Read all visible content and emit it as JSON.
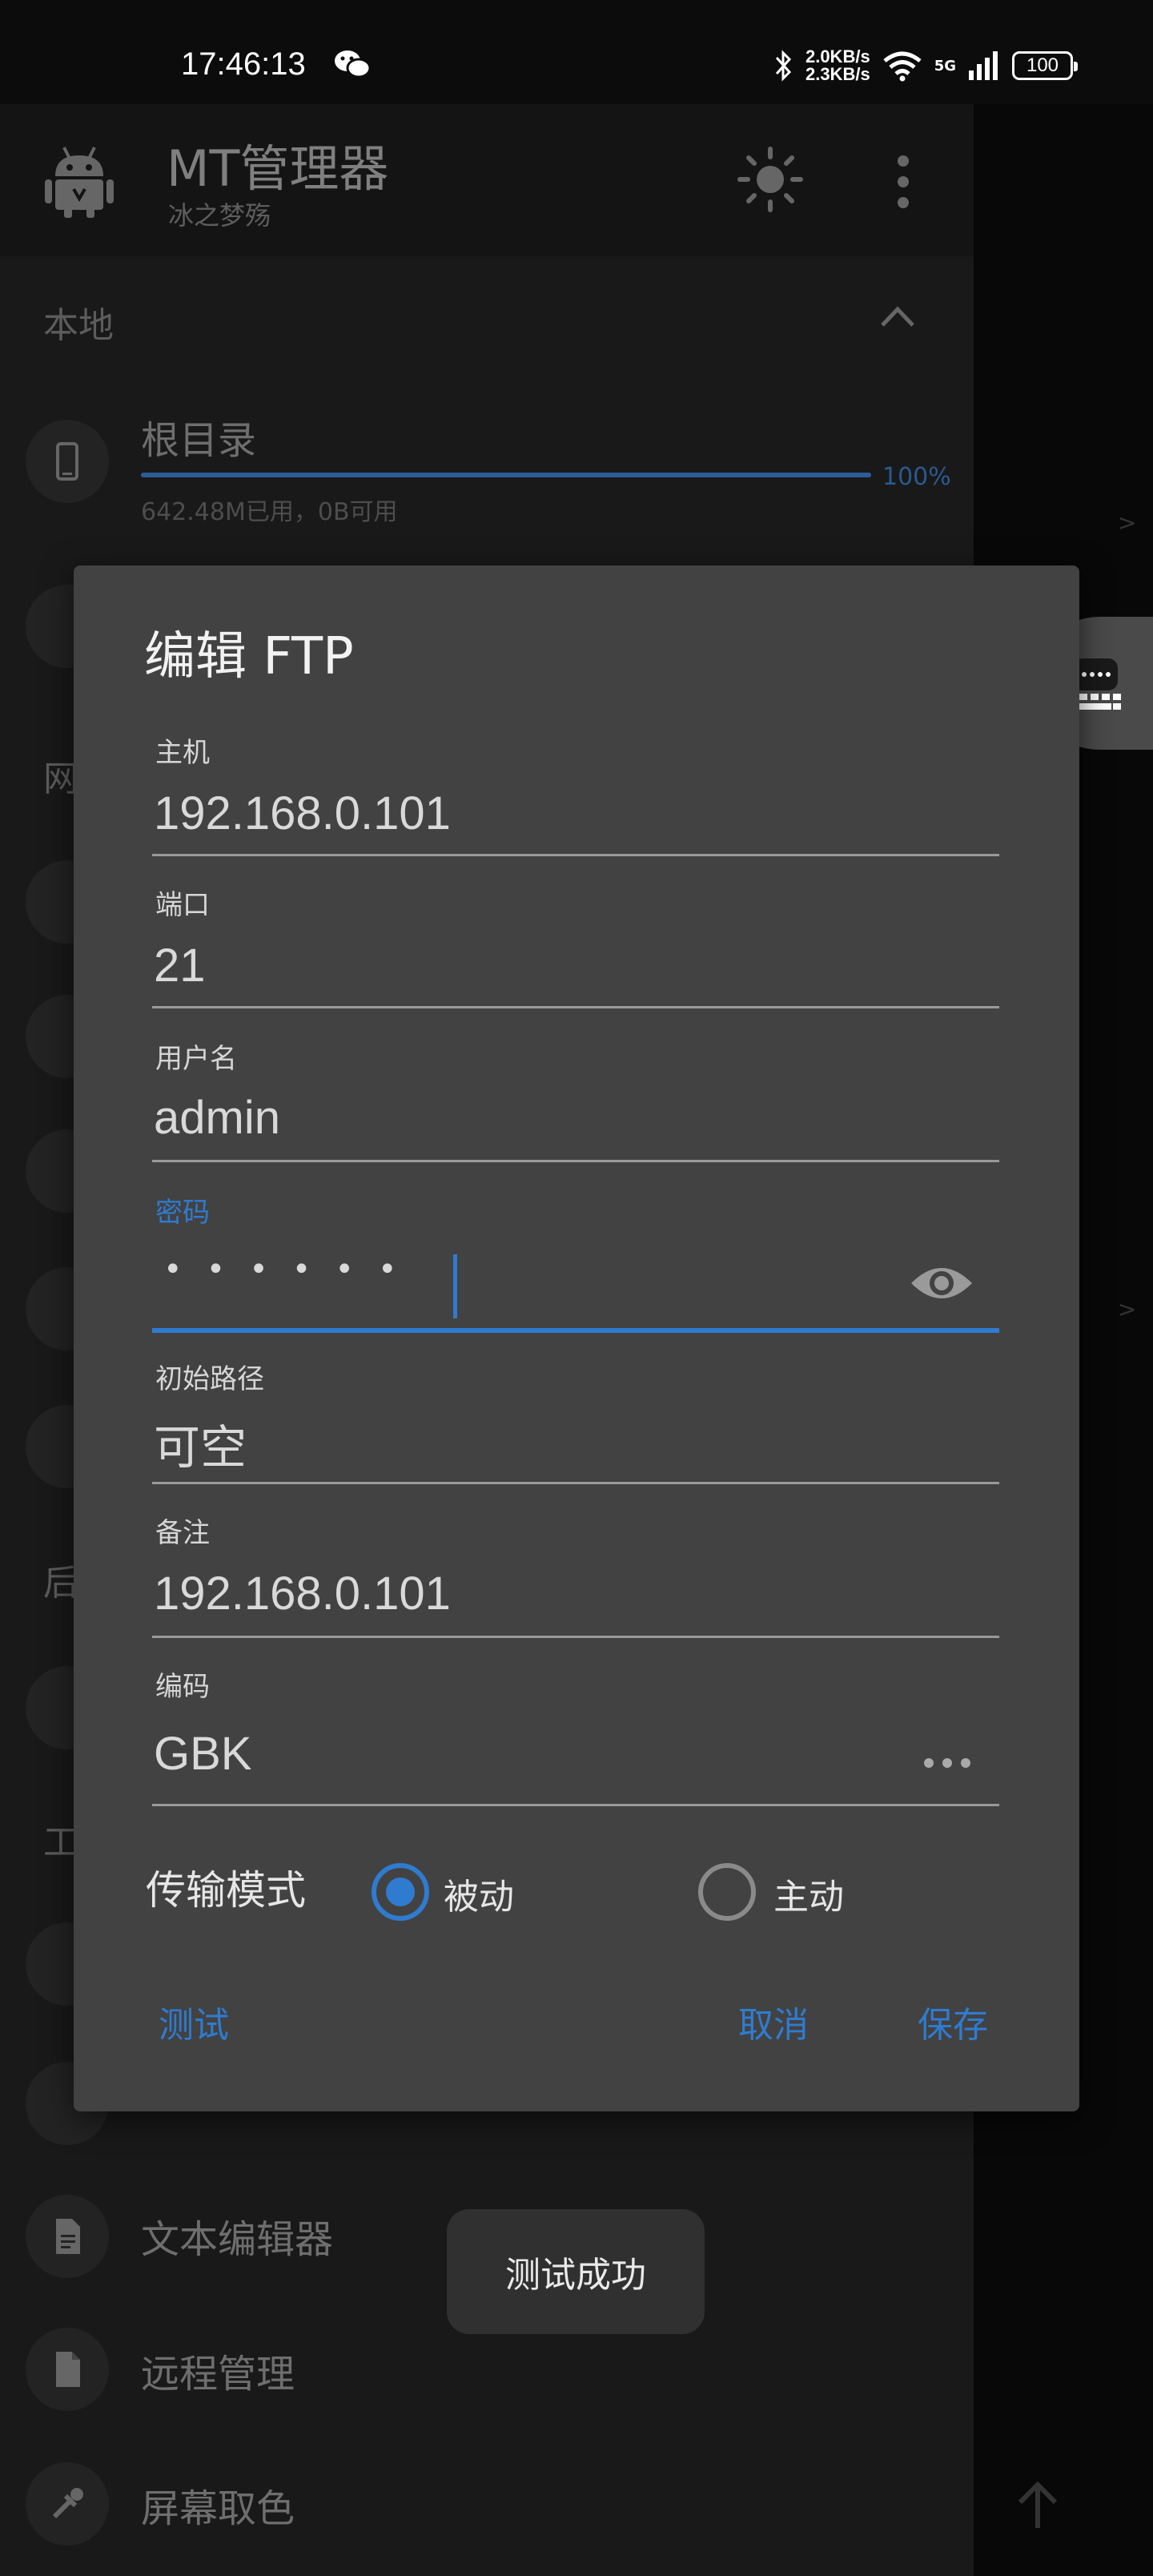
{
  "status_bar": {
    "time": "17:46:13",
    "up_speed": "2.0KB/s",
    "down_speed": "2.3KB/s",
    "network": "5G",
    "battery": "100",
    "icons": [
      "wechat-icon",
      "bluetooth-icon",
      "wifi-icon",
      "signal-icon",
      "battery-icon"
    ]
  },
  "app": {
    "title": "MT管理器",
    "subtitle": "冰之梦殇",
    "icons": [
      "android-logo-icon",
      "brightness-icon",
      "more-vert-icon"
    ]
  },
  "drawer": {
    "section_local": "本地",
    "root_label": "根目录",
    "root_usage_percent": 100,
    "root_usage_label": "100%",
    "root_info": "642.48M已用，0B可用",
    "section_network_partial": "网",
    "section_bookmark_partial": "后",
    "section_tools_partial": "工",
    "items": [
      {
        "label": "文本编辑器",
        "icon": "document-icon"
      },
      {
        "label": "远程管理",
        "icon": "file-icon"
      },
      {
        "label": "屏幕取色",
        "icon": "eyedropper-icon"
      }
    ]
  },
  "dialog": {
    "title": "编辑 FTP",
    "fields": {
      "host": {
        "label": "主机",
        "value": "192.168.0.101"
      },
      "port": {
        "label": "端口",
        "value": "21"
      },
      "username": {
        "label": "用户名",
        "value": "admin"
      },
      "password": {
        "label": "密码",
        "value": "••••••"
      },
      "initial_path": {
        "label": "初始路径",
        "placeholder": "可空"
      },
      "remark": {
        "label": "备注",
        "value": "192.168.0.101"
      },
      "encoding": {
        "label": "编码",
        "value": "GBK"
      }
    },
    "transfer_mode": {
      "label": "传输模式",
      "options": [
        {
          "label": "被动",
          "checked": true
        },
        {
          "label": "主动",
          "checked": false
        }
      ]
    },
    "buttons": {
      "test": "测试",
      "cancel": "取消",
      "save": "保存"
    }
  },
  "toast": "测试成功",
  "colors": {
    "accent": "#2f7bd0",
    "dialog_bg": "#424242",
    "background": "#191919"
  }
}
